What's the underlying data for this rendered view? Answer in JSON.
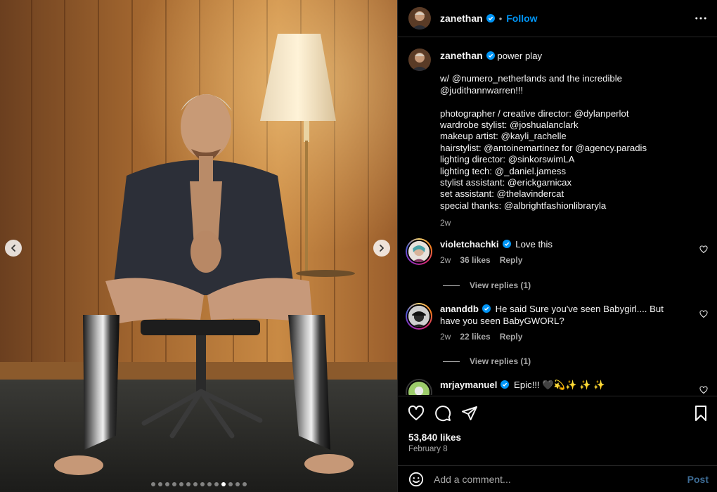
{
  "colors": {
    "accent": "#0095f6",
    "background": "#000000",
    "muted": "#a8a8a8"
  },
  "media": {
    "prev_icon": "chevron-left-icon",
    "next_icon": "chevron-right-icon",
    "dot_count": 14,
    "active_dot_index": 10
  },
  "header": {
    "username": "zanethan",
    "separator": "•",
    "follow_label": "Follow",
    "more_icon": "more-horizontal-icon"
  },
  "caption": {
    "username": "zanethan",
    "title": "power play",
    "lines": [
      "w/ @numero_netherlands and the incredible",
      "@judithannwarren!!!",
      "",
      "photographer / creative director: @dylanperlot",
      "wardrobe stylist: @joshualanclark",
      "makeup artist: @kayli_rachelle",
      "hairstylist: @antoinemartinez for @agency.paradis",
      "lighting director: @sinkorswimLA",
      "lighting tech: @_daniel.jamess",
      "stylist assistant: @erickgarnicax",
      "set assistant: @thelavindercat",
      "special thanks: @albrightfashionlibraryla"
    ],
    "time": "2w"
  },
  "comments": [
    {
      "username": "violetchachki",
      "text": "Love this",
      "time": "2w",
      "likes": "36 likes",
      "reply": "Reply",
      "view_replies": "View replies (1)"
    },
    {
      "username": "ananddb",
      "text": "He said Sure you've seen Babygirl.... But have you seen BabyGWORL?",
      "time": "2w",
      "likes": "22 likes",
      "reply": "Reply",
      "view_replies": "View replies (1)"
    },
    {
      "username": "mrjaymanuel",
      "text": "Epic!!! 🖤💫✨ ✨ ✨"
    }
  ],
  "actions": {
    "like_icon": "heart-icon",
    "comment_icon": "comment-icon",
    "share_icon": "share-icon",
    "save_icon": "bookmark-icon"
  },
  "stats": {
    "likes": "53,840 likes",
    "date": "February 8"
  },
  "add_comment": {
    "placeholder": "Add a comment...",
    "post_label": "Post",
    "emoji_icon": "emoji-icon"
  }
}
